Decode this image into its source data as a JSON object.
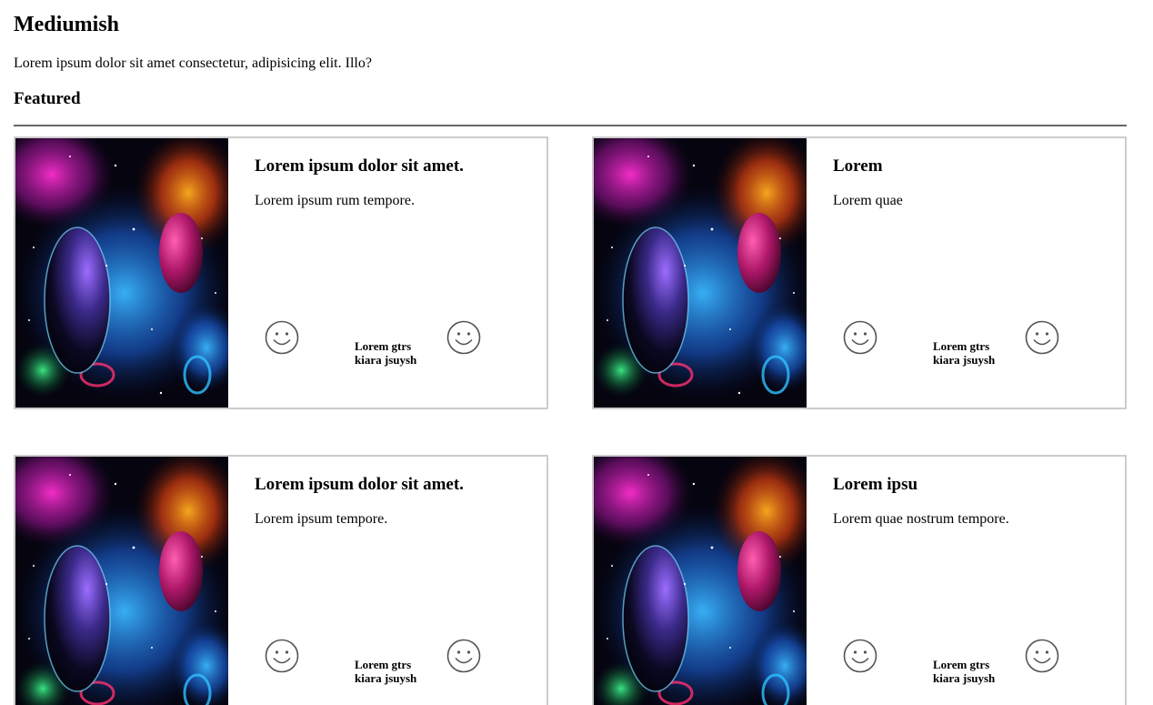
{
  "header": {
    "title": "Mediumish",
    "intro": "Lorem ipsum dolor sit amet consectetur, adipisicing elit. Illo?",
    "section_title": "Featured"
  },
  "cards": [
    {
      "title": "Lorem ipsum dolor sit amet.",
      "text": "Lorem ipsum rum tempore.",
      "author_line1": "Lorem gtrs",
      "author_line2": "kiara jsuysh",
      "icons": [
        "smiley-icon",
        "smiley-icon"
      ]
    },
    {
      "title": "Lorem",
      "text": "Lorem quae",
      "author_line1": "Lorem gtrs",
      "author_line2": "kiara jsuysh",
      "icons": [
        "smiley-icon",
        "smiley-icon"
      ]
    },
    {
      "title": "Lorem ipsum dolor sit amet.",
      "text": "Lorem ipsum tempore.",
      "author_line1": "Lorem gtrs",
      "author_line2": "kiara jsuysh",
      "icons": [
        "smiley-icon",
        "smiley-icon"
      ]
    },
    {
      "title": "Lorem ipsu",
      "text": "Lorem quae nostrum tempore.",
      "author_line1": "Lorem gtrs",
      "author_line2": "kiara jsuysh",
      "icons": [
        "smiley-icon",
        "smiley-icon"
      ]
    }
  ],
  "colors": {
    "card_border": "#cccccc",
    "divider": "#666666",
    "text": "#000000"
  }
}
